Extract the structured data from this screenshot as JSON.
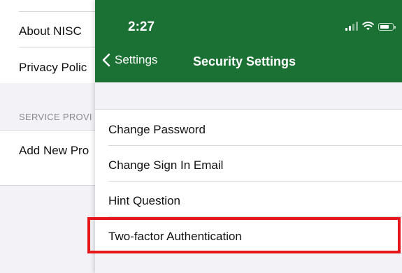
{
  "background_screen": {
    "items": [
      {
        "label": "About NISC"
      },
      {
        "label": "Privacy Polic"
      }
    ],
    "section_header": "SERVICE PROVI",
    "section_items": [
      {
        "label": "Add New Pro"
      }
    ]
  },
  "status_bar": {
    "time": "2:27",
    "icons": [
      "signal-icon",
      "wifi-icon",
      "battery-icon"
    ]
  },
  "nav": {
    "back_label": "Settings",
    "title": "Security Settings",
    "background_color": "#1b7033"
  },
  "settings_list": {
    "items": [
      {
        "label": "Change Password"
      },
      {
        "label": "Change Sign In Email"
      },
      {
        "label": "Hint Question"
      },
      {
        "label": "Two-factor Authentication"
      }
    ]
  },
  "highlight": {
    "target": "Two-factor Authentication",
    "color": "#e5171d"
  }
}
